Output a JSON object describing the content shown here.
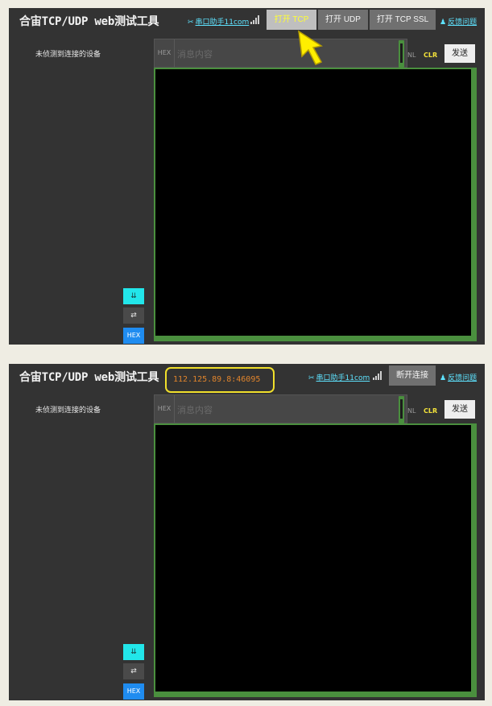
{
  "app": {
    "title": "合宙TCP/UDP web测试工具",
    "serial_link": "串口助手11com",
    "feedback_link": "反馈问题",
    "no_device_text": "未侦测到连接的设备",
    "hex_label": "HEX",
    "message_placeholder": "消息内容",
    "nl_label": "NL",
    "clr_label": "CLR",
    "send_label": "发送",
    "side_hex_label": "HEX"
  },
  "panel1": {
    "buttons": [
      {
        "label": "打开 TCP",
        "active": true
      },
      {
        "label": "打开 UDP",
        "active": false
      },
      {
        "label": "打开 TCP SSL",
        "active": false
      }
    ]
  },
  "panel2": {
    "address": "112.125.89.8:46095",
    "disconnect_label": "断开连接"
  },
  "colors": {
    "panel_bg": "#333333",
    "accent_green": "#4a8f3e",
    "link_cyan": "#5ee3ff",
    "active_text": "#ffff33",
    "address_orange": "#e0842c",
    "highlight_yellow": "#f0df2b",
    "hex_blue": "#1f8cf0"
  }
}
